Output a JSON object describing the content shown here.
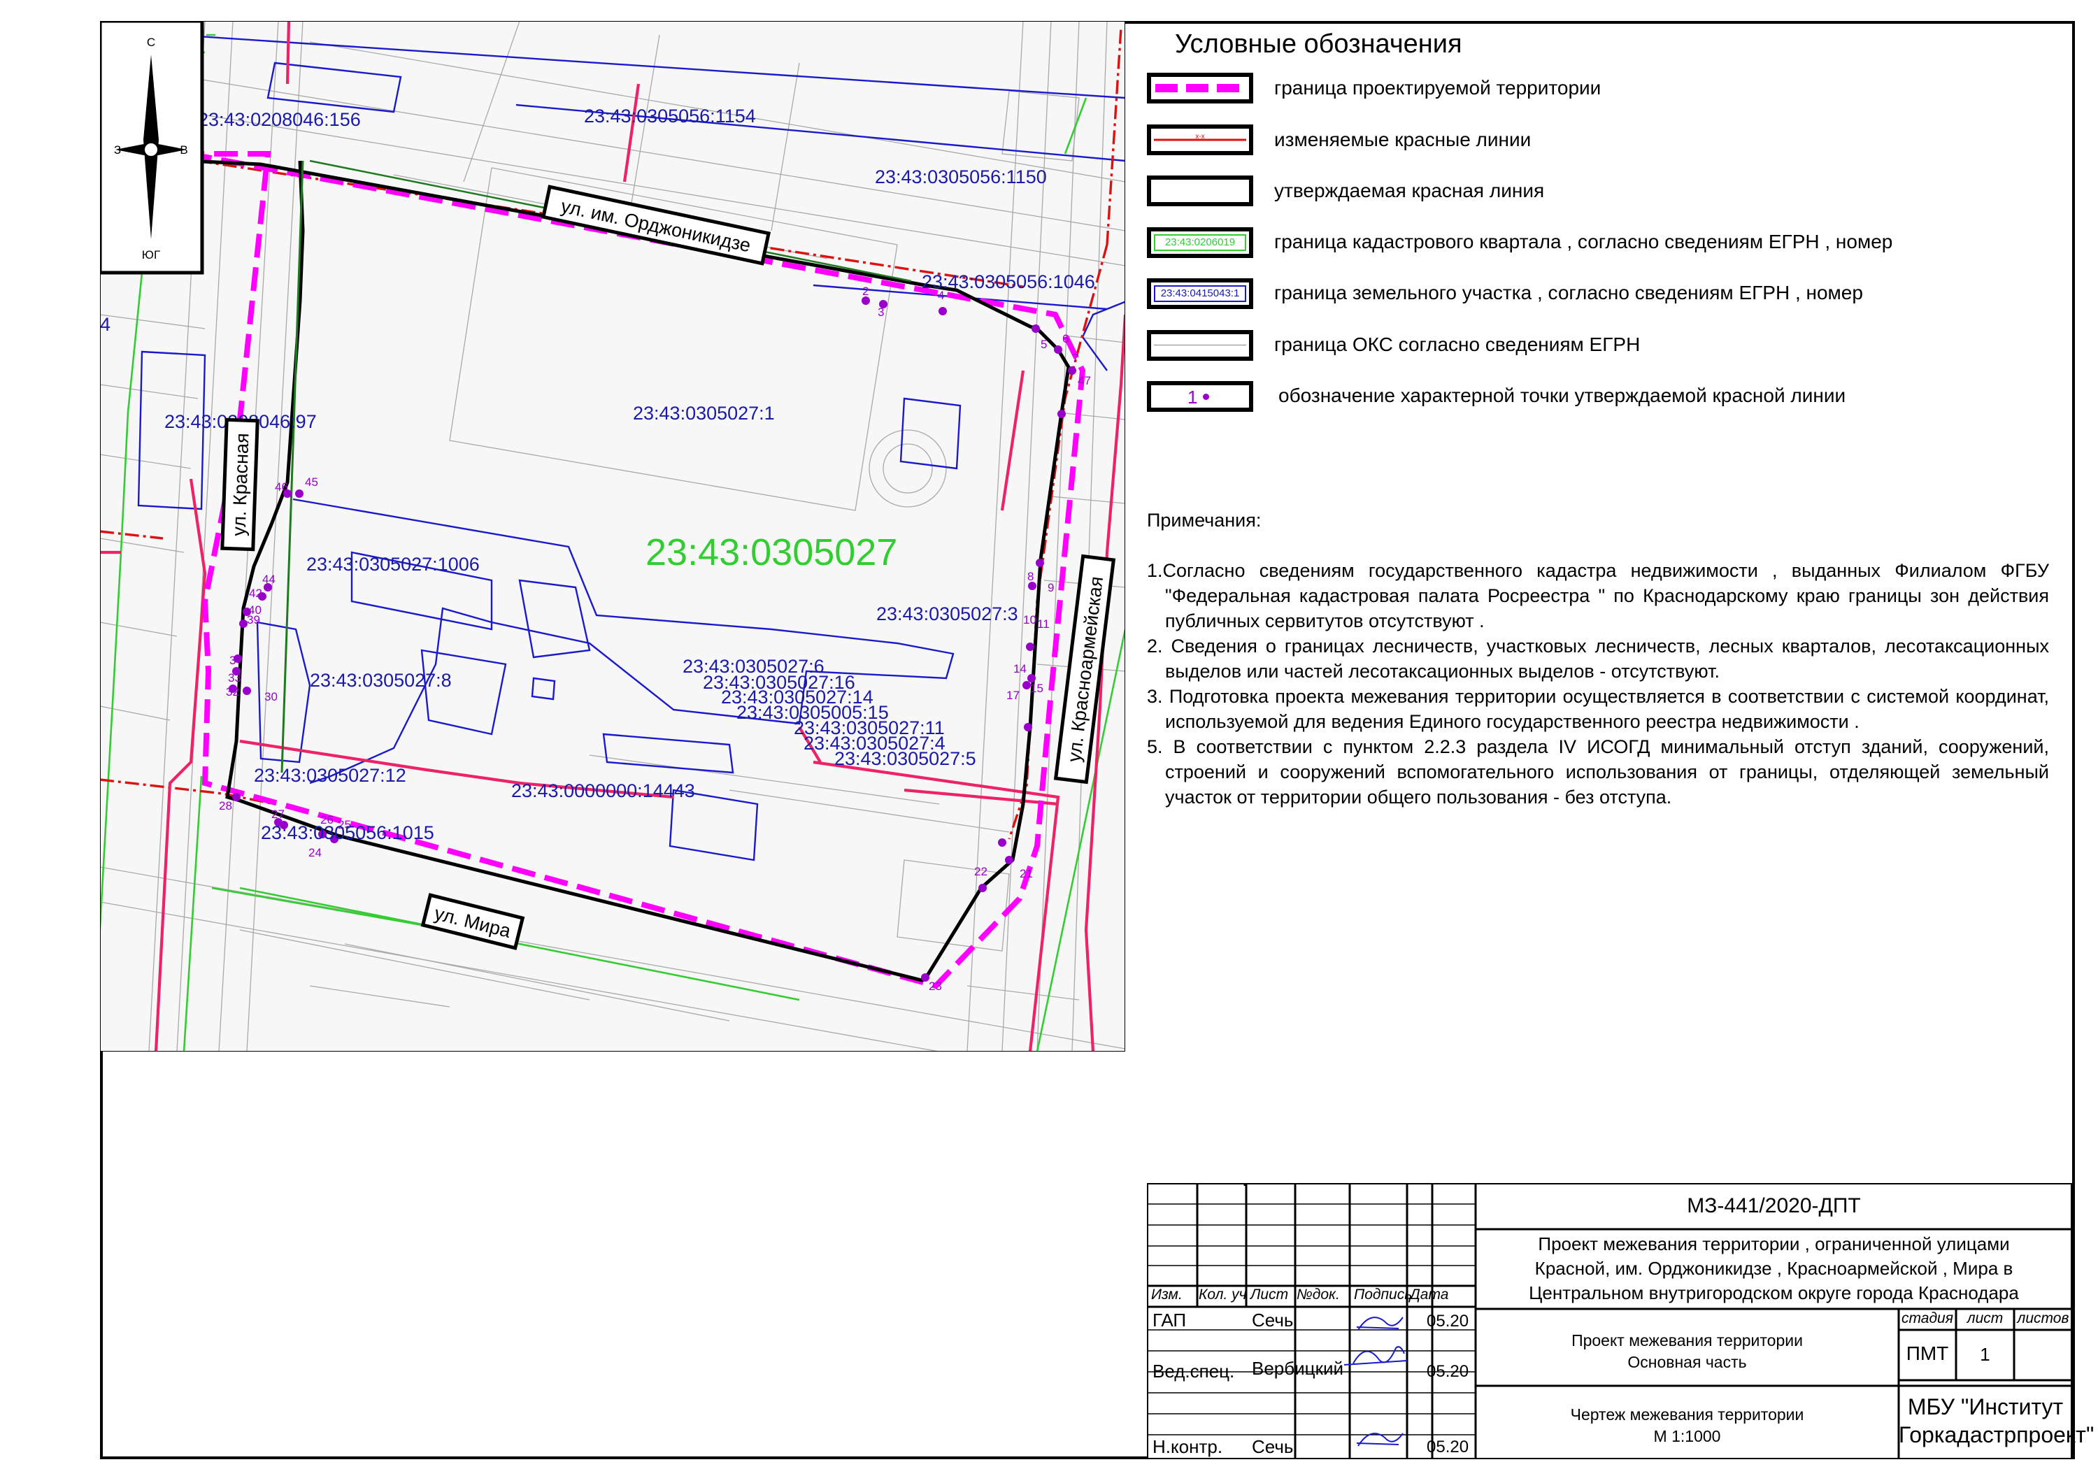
{
  "north_arrow": {
    "north": "С",
    "south": "ЮГ",
    "west": "З",
    "east": "В"
  },
  "map": {
    "quarter_number": "23:43:0305027",
    "parcels": [
      "23:43:0208046:156",
      "23:43:0305056:1154",
      "23:43:0305056:1150",
      "23:43:0305056:1046",
      "23:43:0208046:97",
      "23:43:0305027:1",
      "23:43:0305027:1006",
      "23:43:0305027:3",
      "23:43:0305027:8",
      "23:43:0305027:6",
      "23:43:0305027:16",
      "23:43:0305027:14",
      "23:43:0305005:15",
      "23:43:0305027:11",
      "23:43:0305027:4",
      "23:43:0305027:5",
      "23:43:0305027:12",
      "23:43:0000000:14443",
      "23:43:0305056:1015"
    ],
    "streets": [
      "ул. им. Орджоникидзе",
      "ул. Красная",
      "ул. Красноармейская",
      "ул. Мира"
    ],
    "points": [
      "2",
      "3",
      "4",
      "5",
      "6",
      "7",
      "8",
      "9",
      "10",
      "11",
      "14",
      "15",
      "17",
      "21",
      "22",
      "23",
      "24",
      "25",
      "26",
      "27",
      "28",
      "30",
      "32",
      "33",
      "37",
      "39",
      "40",
      "42",
      "44",
      "45",
      "46",
      "47"
    ],
    "edge_label": "4"
  },
  "legend": {
    "title": "Условные обозначения",
    "items": [
      {
        "label": "граница проектируемой территории"
      },
      {
        "label": "изменяемые красные линии",
        "swatch_text": "x-x"
      },
      {
        "label": "утверждаемая красная линия"
      },
      {
        "label": "граница кадастрового квартала , согласно сведениям ЕГРН , номер",
        "swatch_text": "23:43:0206019"
      },
      {
        "label": "граница земельного участка , согласно сведениям ЕГРН , номер",
        "swatch_text": "23:43:0415043:1"
      },
      {
        "label": "граница ОКС согласно сведениям ЕГРН"
      },
      {
        "label": "обозначение характерной точки утверждаемой красной линии",
        "swatch_text": "1"
      }
    ],
    "colors": {
      "magenta": "#ff00ff",
      "red": "#ee1111",
      "green": "#33cc33",
      "blue": "#0000cc",
      "pink": "#ee2266",
      "purple": "#9900cc"
    }
  },
  "notes": {
    "title": "Примечания:",
    "items": [
      "1.Согласно сведениям государственного кадастра недвижимости , выданных Филиалом ФГБУ \"Федеральная кадастровая палата Росреестра \" по Краснодарскому краю границы зон действия публичных сервитутов отсутствуют .",
      "2. Сведения о границах лесничеств, участковых лесничеств, лесных кварталов, лесотаксационных выделов или частей лесотаксационных выделов - отсутствуют.",
      "3. Подготовка проекта межевания территории осуществляется в соответствии с системой координат, используемой для ведения Единого государственного реестра недвижимости .",
      "5. В соответствии с пунктом 2.2.3 раздела IV ИСОГД минимальный отступ зданий, сооружений, строений и сооружений вспомогательного использования от границы, отделяющей земельный участок от территории общего пользования - без отступа."
    ]
  },
  "stamp": {
    "code": "МЗ-441/2020-ДПТ",
    "project_title": [
      "Проект межевания территории , ограниченной улицами",
      "Красной, им. Орджоникидзе , Красноармейской , Мира в",
      "Центральном внутригородском округе города Краснодара"
    ],
    "headers": [
      "Изм.",
      "Кол. уч",
      "Лист",
      "№док.",
      "Подпись",
      "Дата"
    ],
    "rows": [
      {
        "role": "ГАП",
        "name": "Сечь",
        "date": "05.20"
      },
      {
        "role": "Вед.спец.",
        "name": "Вербицкий",
        "date": "05.20"
      },
      {
        "role": "Н.контр.",
        "name": "Сечь",
        "date": "05.20"
      }
    ],
    "doc_part": [
      "Проект межевания территории",
      "Основная часть"
    ],
    "stage_headers": [
      "стадия",
      "лист",
      "листов"
    ],
    "stage": "ПМТ",
    "sheet": "1",
    "sheets": "",
    "drawing": [
      "Чертеж межевания территории",
      "М 1:1000"
    ],
    "org": [
      "МБУ \"Институт",
      "Горкадастрпроект\""
    ]
  }
}
